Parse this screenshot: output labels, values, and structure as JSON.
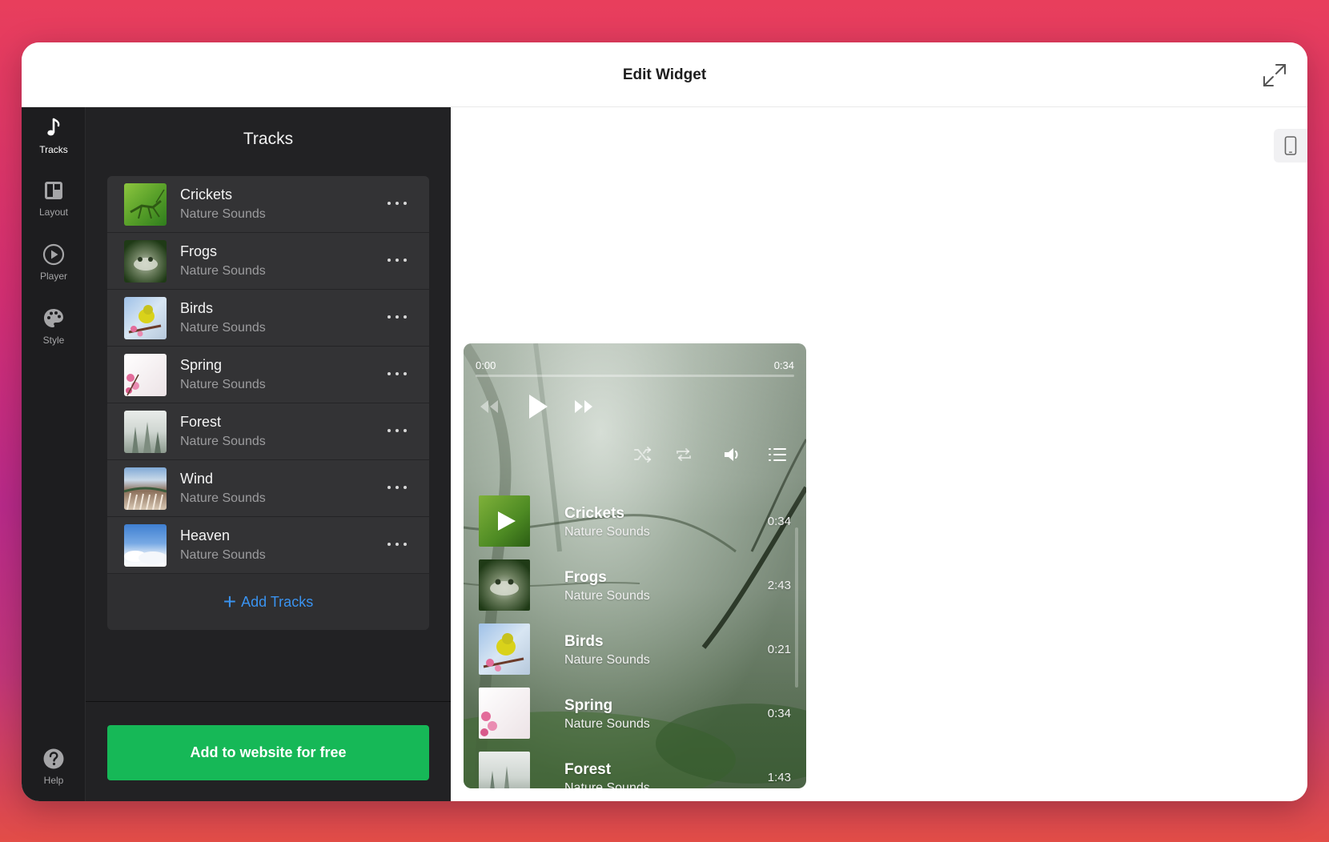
{
  "window": {
    "title": "Edit Widget"
  },
  "rail": {
    "items": [
      {
        "label": "Tracks",
        "icon": "music-note-icon",
        "active": true
      },
      {
        "label": "Layout",
        "icon": "layout-icon",
        "active": false
      },
      {
        "label": "Player",
        "icon": "play-circle-icon",
        "active": false
      },
      {
        "label": "Style",
        "icon": "palette-icon",
        "active": false
      }
    ],
    "help": {
      "label": "Help",
      "icon": "help-icon"
    }
  },
  "panel": {
    "title": "Tracks",
    "tracks": [
      {
        "name": "Crickets",
        "artist": "Nature Sounds"
      },
      {
        "name": "Frogs",
        "artist": "Nature Sounds"
      },
      {
        "name": "Birds",
        "artist": "Nature Sounds"
      },
      {
        "name": "Spring",
        "artist": "Nature Sounds"
      },
      {
        "name": "Forest",
        "artist": "Nature Sounds"
      },
      {
        "name": "Wind",
        "artist": "Nature Sounds"
      },
      {
        "name": "Heaven",
        "artist": "Nature Sounds"
      }
    ],
    "add_tracks_plus": "+",
    "add_tracks_label": "Add Tracks",
    "cta_label": "Add to website for free"
  },
  "player": {
    "time_current": "0:00",
    "time_total": "0:34",
    "progress": 0,
    "playlist": [
      {
        "name": "Crickets",
        "artist": "Nature Sounds",
        "duration": "0:34"
      },
      {
        "name": "Frogs",
        "artist": "Nature Sounds",
        "duration": "2:43"
      },
      {
        "name": "Birds",
        "artist": "Nature Sounds",
        "duration": "0:21"
      },
      {
        "name": "Spring",
        "artist": "Nature Sounds",
        "duration": "0:34"
      },
      {
        "name": "Forest",
        "artist": "Nature Sounds",
        "duration": "1:43"
      }
    ]
  },
  "colors": {
    "accent_green": "#16b857",
    "link_blue": "#3a93f0",
    "panel_bg": "#222224",
    "rail_bg": "#1d1d1f"
  }
}
